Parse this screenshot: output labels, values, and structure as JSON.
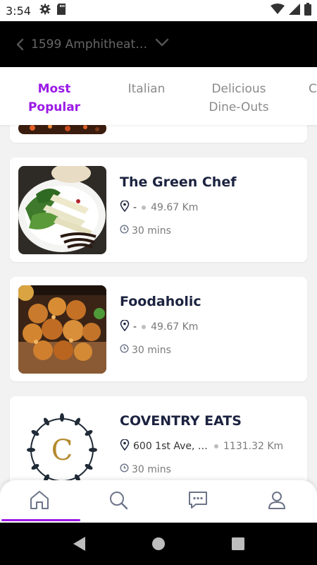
{
  "status_bar": {
    "time": "3:54",
    "icons": [
      "gear-icon",
      "sd-card-icon",
      "wifi-icon",
      "signal-icon",
      "battery-icon"
    ]
  },
  "header": {
    "location": "1599 Amphitheatre..."
  },
  "tabs": [
    {
      "label": "Most Popular",
      "active": true
    },
    {
      "label": "Italian",
      "active": false
    },
    {
      "label": "Delicious Dine-Outs",
      "active": false
    },
    {
      "label": "C",
      "active": false
    }
  ],
  "restaurants": [
    {
      "name": "The Green Chef",
      "address": "-",
      "distance": "49.67 Km",
      "time": "30 mins"
    },
    {
      "name": "Foodaholic",
      "address": "-",
      "distance": "49.67 Km",
      "time": "30 mins"
    },
    {
      "name": "COVENTRY EATS",
      "address": "600 1st Ave, S...",
      "distance": "1131.32 Km",
      "time": "30 mins",
      "logo_letter": "C"
    }
  ],
  "bottom_nav": [
    "home-icon",
    "search-icon",
    "chat-icon",
    "profile-icon"
  ],
  "colors": {
    "accent": "#9b19e6",
    "title": "#1c2340",
    "header_bg": "#000000"
  }
}
